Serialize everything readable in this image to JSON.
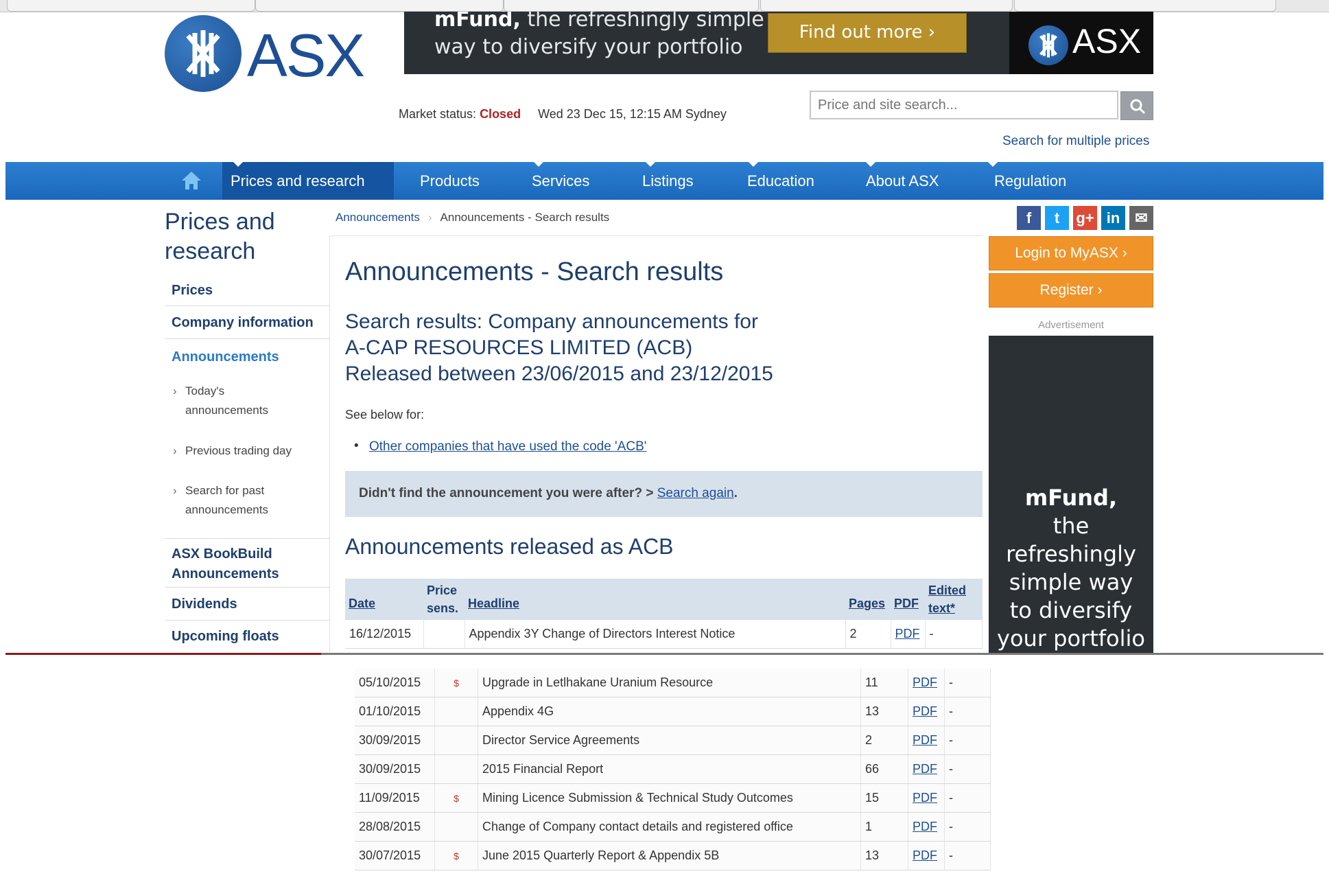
{
  "site": {
    "logo_text": "ASX"
  },
  "banner": {
    "line1_bold": "mFund,",
    "line1_rest": " the refreshingly simple",
    "line2": "way to diversify your portfolio",
    "button": "Find out more ›",
    "logo_text": "ASX"
  },
  "market": {
    "label": "Market status:",
    "status": "Closed",
    "datetime": "Wed 23 Dec 15, 12:15 AM Sydney"
  },
  "search": {
    "placeholder": "Price and site search...",
    "multi_link": "Search for multiple prices"
  },
  "nav": {
    "items": [
      "Prices and research",
      "Products",
      "Services",
      "Listings",
      "Education",
      "About ASX",
      "Regulation"
    ]
  },
  "sidebar": {
    "title_line1": "Prices and",
    "title_line2": "research",
    "items": [
      "Prices",
      "Company information",
      "Announcements",
      "ASX BookBuild Announcements",
      "Dividends",
      "Upcoming floats"
    ],
    "sub_items": [
      {
        "line1": "Today's",
        "line2": "announcements"
      },
      {
        "line1": "Previous trading day",
        "line2": ""
      },
      {
        "line1": "Search for past",
        "line2": "announcements"
      }
    ]
  },
  "breadcrumb": {
    "first": "Announcements",
    "second": "Announcements - Search results"
  },
  "main": {
    "title": "Announcements - Search results",
    "subtitle_line1": "Search results: Company announcements for",
    "subtitle_line2": "A-CAP RESOURCES LIMITED (ACB)",
    "subtitle_line3": "Released between 23/06/2015 and 23/12/2015",
    "see_below": "See below for:",
    "bullet_link": "Other companies that have used the code 'ACB'",
    "notfound_text": "Didn't find the announcement you were after? > ",
    "notfound_link": "Search again",
    "notfound_end": ".",
    "section_title": "Announcements released as ACB"
  },
  "table": {
    "headers": {
      "date": "Date",
      "sens_line1": "Price",
      "sens_line2": "sens.",
      "headline": "Headline",
      "pages": "Pages",
      "pdf": "PDF",
      "edited_line1": "Edited",
      "edited_line2": "text*"
    },
    "rows_top": [
      {
        "date": "16/12/2015",
        "sens": "",
        "headline": "Appendix 3Y Change of Directors Interest Notice",
        "pages": "2",
        "pdf": "PDF",
        "edited": "-"
      }
    ],
    "rows_bottom": [
      {
        "date": "05/10/2015",
        "sens": "$",
        "headline": "Upgrade in Letlhakane Uranium Resource",
        "pages": "11",
        "pdf": "PDF",
        "edited": "-"
      },
      {
        "date": "01/10/2015",
        "sens": "",
        "headline": "Appendix 4G",
        "pages": "13",
        "pdf": "PDF",
        "edited": "-"
      },
      {
        "date": "30/09/2015",
        "sens": "",
        "headline": "Director Service Agreements",
        "pages": "2",
        "pdf": "PDF",
        "edited": "-"
      },
      {
        "date": "30/09/2015",
        "sens": "",
        "headline": "2015 Financial Report",
        "pages": "66",
        "pdf": "PDF",
        "edited": "-"
      },
      {
        "date": "11/09/2015",
        "sens": "$",
        "headline": "Mining Licence Submission & Technical Study Outcomes",
        "pages": "15",
        "pdf": "PDF",
        "edited": "-"
      },
      {
        "date": "28/08/2015",
        "sens": "",
        "headline": "Change of Company contact details and registered office",
        "pages": "1",
        "pdf": "PDF",
        "edited": "-"
      },
      {
        "date": "30/07/2015",
        "sens": "$",
        "headline": "June 2015 Quarterly Report & Appendix 5B",
        "pages": "13",
        "pdf": "PDF",
        "edited": "-"
      }
    ]
  },
  "right": {
    "social": [
      "f",
      "t",
      "g+",
      "in",
      "✉"
    ],
    "social_colors": [
      "#3b5998",
      "#1da1f2",
      "#dd4b39",
      "#0077b5",
      "#666666"
    ],
    "login": "Login to MyASX ›",
    "register": "Register ›",
    "ad_label": "Advertisement",
    "ad_line1": "mFund,",
    "ad_line2": "the refreshingly",
    "ad_line3": "simple way",
    "ad_line4": "to diversify",
    "ad_line5": "your portfolio"
  }
}
